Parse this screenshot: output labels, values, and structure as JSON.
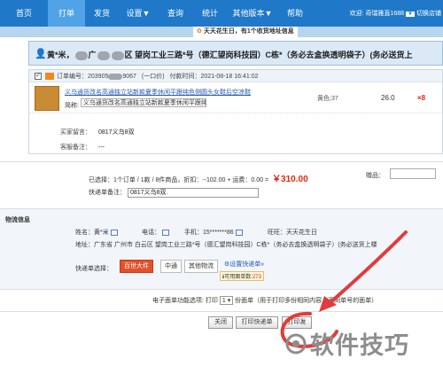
{
  "nav": {
    "tabs": [
      "首页",
      "打单",
      "发货",
      "设置▼",
      "查询",
      "统计",
      "其他版本▼",
      "帮助"
    ],
    "active_tab": "打单",
    "welcome_prefix": "欢迎: ",
    "user": "奇瑞雅直1688",
    "switch_label": "切换店铺"
  },
  "birthday_banner": "天天花生日，有1个收货地址信息",
  "address_header": {
    "name": "黄*米，",
    "city_fragment": "广",
    "address": "区 望岗工业三路*号（德汇望岗科技园）C栋*（务必去盒换透明袋子）(务必送货上"
  },
  "order": {
    "id_label": "订单编号：",
    "id_prefix": "203905",
    "id_suffix": "9067",
    "status_text": "(一口价)",
    "paid_label": "付款时间：",
    "paid_time": "2021-08-18 16:41:02",
    "item": {
      "name": "义乌通货改名高通独立站新款夏季休闲平跟纯色侧圆头女鞋后空凉鞋",
      "abbr_label": "简称:",
      "abbr_value": "义乌通货改名高通独立站新款夏季休闲平跟纯色侧圆:",
      "spec": "黄色;37",
      "price": "26.0",
      "qty": "×8"
    },
    "buyer_msg_label": "买家留言：",
    "buyer_msg": "0817义乌8双",
    "seller_note_label": "客服备注：",
    "seller_note": "---"
  },
  "summary": {
    "text": "已选择：1个订单 / 1款 / 8件商品，折扣：--102.00 + 运费：0.00  =",
    "total": "￥310.00",
    "gift_label": "赠品："
  },
  "express_note": {
    "label": "快递单备注：",
    "value": "0817义乌8双."
  },
  "logistics": {
    "title": "物流信息",
    "name_label": "姓名：",
    "name": "黄*米",
    "phone_label": "电话：",
    "mobile_label": "手机：",
    "mobile": "15*******86",
    "wangwang_label": "旺旺：",
    "wangwang": "天天花生日",
    "addr_label": "地址：",
    "addr": "广东省 广州市 白云区 望岗工业三路*号（德汇望岗科技园）C栋*（务必去盒换透明袋子）(务必送货上楼",
    "express_label": "快递单选择：",
    "express_options": [
      "百世大件",
      "中通",
      "其他物流"
    ],
    "selected_express": "百世大件",
    "setting_link": "设置快递单»",
    "remain_label": "可用面单数:",
    "remain_count": "273"
  },
  "print_options": {
    "label": "电子面单功能选项: 打印",
    "count": "1",
    "suffix": "份面单（用于打印多份相同内容，不同单号的面单）"
  },
  "buttons": {
    "close": "关闭",
    "print_express": "打印快递单",
    "print_invoice": "打印发"
  },
  "watermark": "软件技巧",
  "colors": {
    "nav_bg": "#1f78c8",
    "nav_active": "#4fa3e6",
    "total": "#e5260f",
    "selected_express": "#e2512a",
    "annotation": "#e23b3b"
  }
}
